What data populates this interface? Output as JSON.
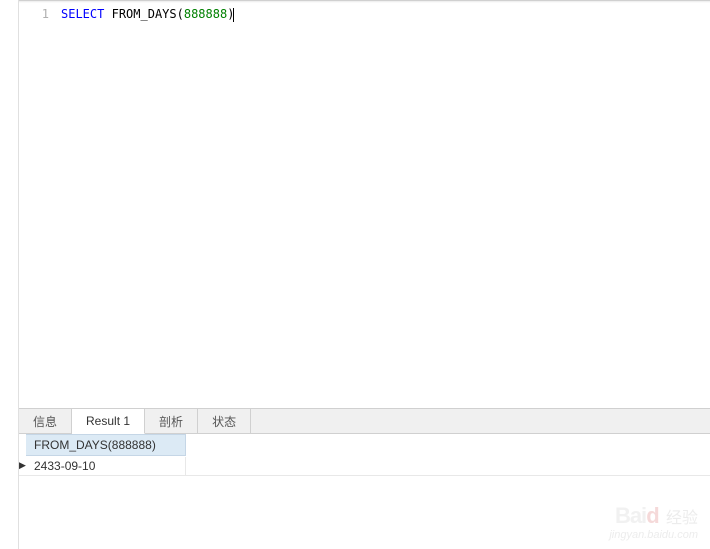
{
  "editor": {
    "line_number": "1",
    "keyword_select": "SELECT",
    "space1": " ",
    "func_name": "FROM_DAYS",
    "paren_open": "(",
    "arg_value": "888888",
    "paren_close": ")"
  },
  "tabs": {
    "info": "信息",
    "result1": "Result 1",
    "profile": "剖析",
    "status": "状态"
  },
  "results": {
    "column_header": "FROM_DAYS(888888)",
    "rows": [
      {
        "value": "2433-09-10"
      }
    ]
  },
  "watermark": {
    "logo_prefix": "Bai",
    "logo_suffix": "d",
    "logo_text": "经验",
    "url": "jingyan.baidu.com"
  }
}
